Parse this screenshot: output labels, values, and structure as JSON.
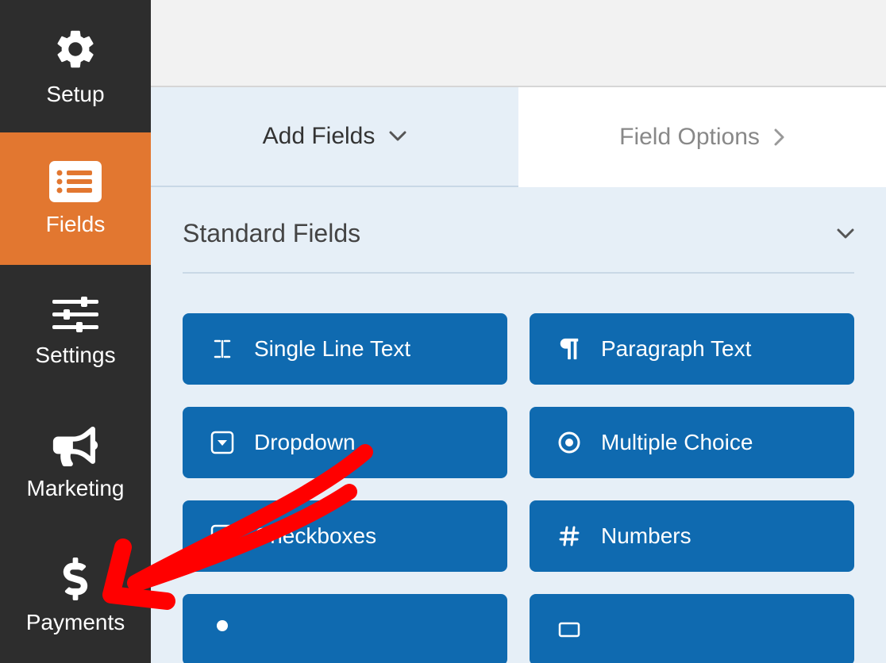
{
  "sidebar": {
    "items": [
      {
        "label": "Setup"
      },
      {
        "label": "Fields"
      },
      {
        "label": "Settings"
      },
      {
        "label": "Marketing"
      },
      {
        "label": "Payments"
      }
    ]
  },
  "tabs": {
    "add": "Add Fields",
    "options": "Field Options"
  },
  "section": {
    "title": "Standard Fields"
  },
  "fields": {
    "single_line": "Single Line Text",
    "paragraph": "Paragraph Text",
    "dropdown": "Dropdown",
    "multiple_choice": "Multiple Choice",
    "checkboxes": "Checkboxes",
    "numbers": "Numbers"
  },
  "colors": {
    "accent": "#e27730",
    "button": "#0f6ab0",
    "annotation": "#ff0000"
  }
}
